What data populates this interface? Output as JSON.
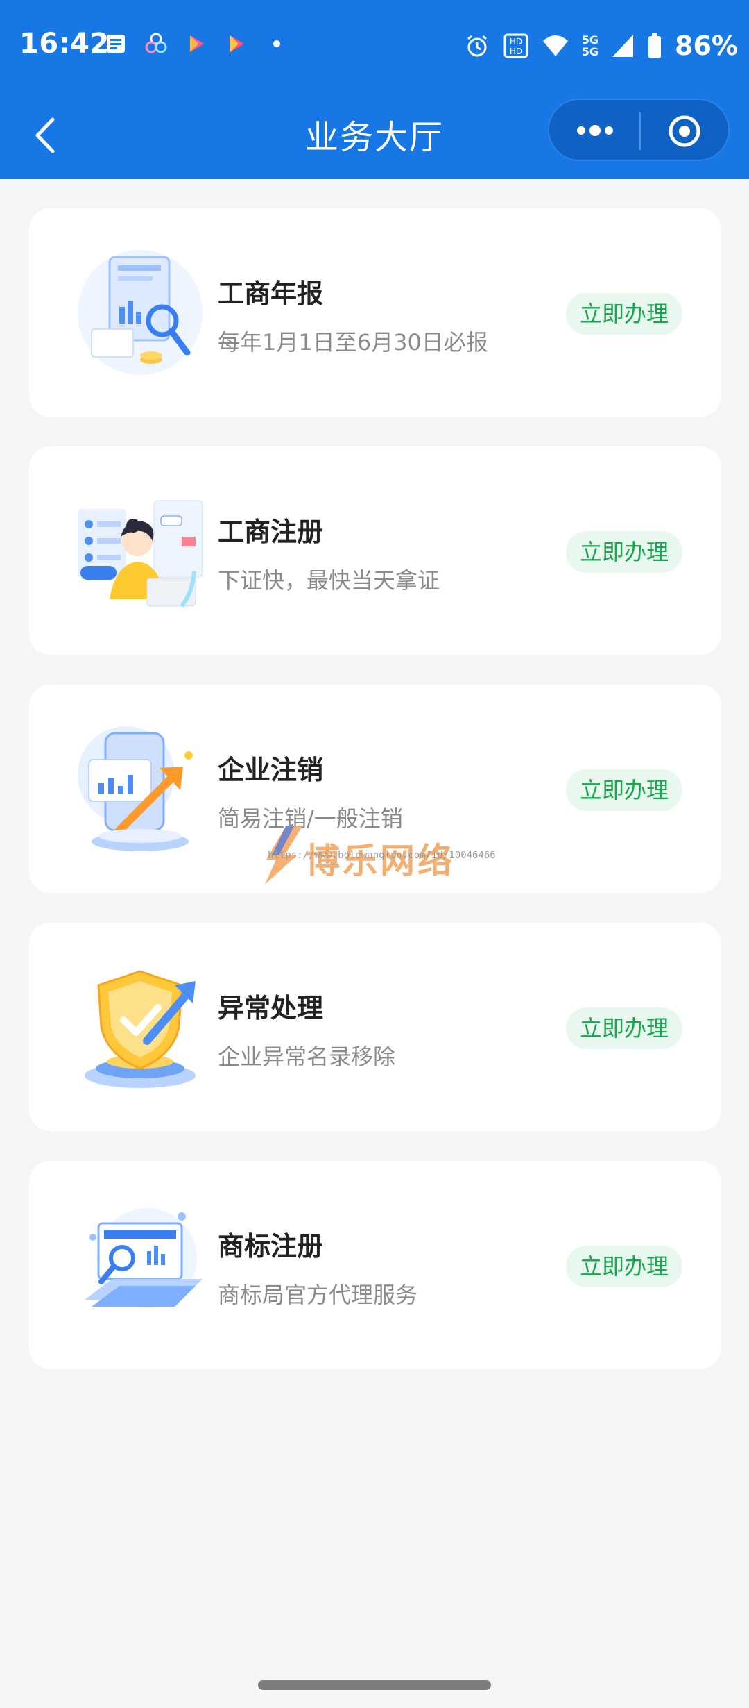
{
  "status_bar": {
    "time": "16:42",
    "network": "5G",
    "network2": "5G",
    "battery": "86%"
  },
  "nav": {
    "title": "业务大厅"
  },
  "cards": [
    {
      "title": "工商年报",
      "subtitle": "每年1月1日至6月30日必报",
      "action": "立即办理"
    },
    {
      "title": "工商注册",
      "subtitle": "下证快，最快当天拿证",
      "action": "立即办理"
    },
    {
      "title": "企业注销",
      "subtitle": "简易注销/一般注销",
      "action": "立即办理"
    },
    {
      "title": "异常处理",
      "subtitle": "企业异常名录移除",
      "action": "立即办理"
    },
    {
      "title": "商标注册",
      "subtitle": "商标局官方代理服务",
      "action": "立即办理"
    }
  ],
  "watermark": {
    "text": "博乐网络",
    "url": "https://www.bolewangluo.com/id/10046466"
  },
  "colors": {
    "brand_blue": "#1677e5",
    "action_green": "#1aa64f",
    "action_bg": "#e8f8ef"
  }
}
